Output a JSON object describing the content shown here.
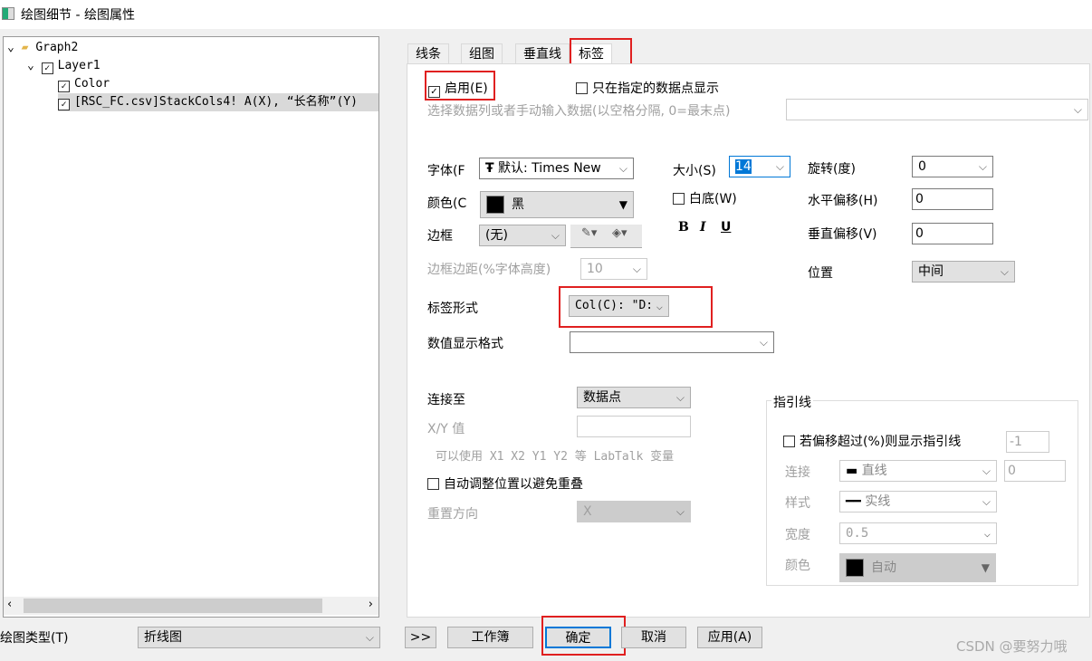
{
  "window": {
    "title": "绘图细节 - 绘图属性"
  },
  "tree": {
    "items": [
      {
        "label": "Graph2",
        "checked": null
      },
      {
        "label": "Layer1",
        "checked": true
      },
      {
        "label": "Color",
        "checked": true
      },
      {
        "label": "[RSC_FC.csv]StackCols4! A(X), “长名称”(Y)",
        "checked": true
      }
    ]
  },
  "plot_type": {
    "label": "绘图类型(T)",
    "value": "折线图"
  },
  "tabs": [
    "线条",
    "组图",
    "垂直线",
    "标签"
  ],
  "active_tab": "标签",
  "label_tab": {
    "enable": {
      "label": "启用(E)",
      "checked": true
    },
    "only_specified": {
      "label": "只在指定的数据点显示",
      "checked": false
    },
    "select_hint": "选择数据列或者手动输入数据(以空格分隔, 0=最末点)",
    "font": {
      "label": "字体(F",
      "value": "默认: Times New"
    },
    "color": {
      "label": "颜色(C",
      "value": "黑"
    },
    "border": {
      "label": "边框",
      "value": "(无)"
    },
    "border_margin": {
      "label": "边框边距(%字体高度)",
      "value": "10"
    },
    "size": {
      "label": "大小(S)",
      "value": "14"
    },
    "white_bg": {
      "label": "白底(W)",
      "checked": false
    },
    "bold": "B",
    "italic": "I",
    "underline": "U",
    "rotation": {
      "label": "旋转(度)",
      "value": "0"
    },
    "h_offset": {
      "label": "水平偏移(H)",
      "value": "0"
    },
    "v_offset": {
      "label": "垂直偏移(V)",
      "value": "0"
    },
    "position": {
      "label": "位置",
      "value": "中间"
    },
    "label_form": {
      "label": "标签形式",
      "value": "Col(C): \"D:"
    },
    "num_format": {
      "label": "数值显示格式",
      "value": ""
    },
    "connect_to": {
      "label": "连接至",
      "value": "数据点"
    },
    "xy_value": {
      "label": "X/Y 值",
      "value": ""
    },
    "labtalk_hint": "可以使用 X1 X2 Y1 Y2 等 LabTalk 变量",
    "auto_adjust": {
      "label": "自动调整位置以避免重叠",
      "checked": false
    },
    "reset_dir": {
      "label": "重置方向",
      "value": "X"
    },
    "leader": {
      "title": "指引线",
      "show_if": {
        "label": "若偏移超过(%)则显示指引线",
        "checked": false,
        "value": "-1"
      },
      "connect": {
        "label": "连接",
        "value": "直线",
        "extra": "0"
      },
      "style": {
        "label": "样式",
        "value": "实线"
      },
      "width": {
        "label": "宽度",
        "value": "0.5"
      },
      "color": {
        "label": "颜色",
        "value": "自动"
      }
    }
  },
  "buttons": {
    "more": ">>",
    "workbook": "工作簿",
    "ok": "确定",
    "cancel": "取消",
    "apply": "应用(A)"
  },
  "watermark": "CSDN @要努力哦"
}
